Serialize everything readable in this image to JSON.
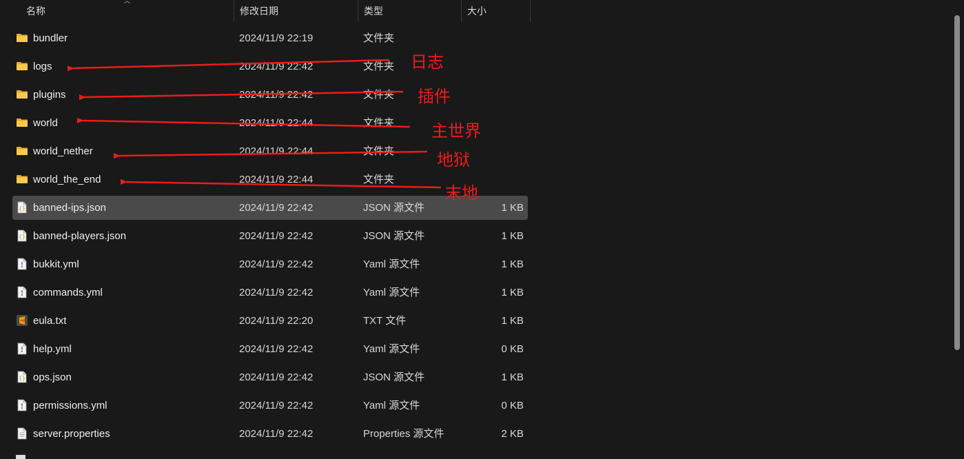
{
  "header": {
    "name": "名称",
    "date": "修改日期",
    "type": "类型",
    "size": "大小"
  },
  "files": [
    {
      "icon": "folder-icon",
      "name": "bundler",
      "date": "2024/11/9 22:19",
      "type": "文件夹",
      "size": ""
    },
    {
      "icon": "folder-icon",
      "name": "logs",
      "date": "2024/11/9 22:42",
      "type": "文件夹",
      "size": ""
    },
    {
      "icon": "folder-icon",
      "name": "plugins",
      "date": "2024/11/9 22:42",
      "type": "文件夹",
      "size": ""
    },
    {
      "icon": "folder-icon",
      "name": "world",
      "date": "2024/11/9 22:44",
      "type": "文件夹",
      "size": ""
    },
    {
      "icon": "folder-icon",
      "name": "world_nether",
      "date": "2024/11/9 22:44",
      "type": "文件夹",
      "size": ""
    },
    {
      "icon": "folder-icon",
      "name": "world_the_end",
      "date": "2024/11/9 22:44",
      "type": "文件夹",
      "size": ""
    },
    {
      "icon": "json-file-icon",
      "name": "banned-ips.json",
      "date": "2024/11/9 22:42",
      "type": "JSON 源文件",
      "size": "1 KB",
      "selected": true
    },
    {
      "icon": "json-file-icon",
      "name": "banned-players.json",
      "date": "2024/11/9 22:42",
      "type": "JSON 源文件",
      "size": "1 KB"
    },
    {
      "icon": "yaml-file-icon",
      "name": "bukkit.yml",
      "date": "2024/11/9 22:42",
      "type": "Yaml 源文件",
      "size": "1 KB"
    },
    {
      "icon": "yaml-file-icon",
      "name": "commands.yml",
      "date": "2024/11/9 22:42",
      "type": "Yaml 源文件",
      "size": "1 KB"
    },
    {
      "icon": "sublime-text-file-icon",
      "name": "eula.txt",
      "date": "2024/11/9 22:20",
      "type": "TXT 文件",
      "size": "1 KB"
    },
    {
      "icon": "yaml-file-icon",
      "name": "help.yml",
      "date": "2024/11/9 22:42",
      "type": "Yaml 源文件",
      "size": "0 KB"
    },
    {
      "icon": "json-file-icon",
      "name": "ops.json",
      "date": "2024/11/9 22:42",
      "type": "JSON 源文件",
      "size": "1 KB"
    },
    {
      "icon": "yaml-file-icon",
      "name": "permissions.yml",
      "date": "2024/11/9 22:42",
      "type": "Yaml 源文件",
      "size": "0 KB"
    },
    {
      "icon": "generic-file-icon",
      "name": "server.properties",
      "date": "2024/11/9 22:42",
      "type": "Properties 源文件",
      "size": "2 KB"
    }
  ],
  "annotations": [
    {
      "label": "日志",
      "target": "logs"
    },
    {
      "label": "插件",
      "target": "plugins"
    },
    {
      "label": "主世界",
      "target": "world"
    },
    {
      "label": "地狱",
      "target": "world_nether"
    },
    {
      "label": "末地",
      "target": "world_the_end"
    }
  ],
  "colors": {
    "background": "#191919",
    "selected_row": "#4a4a4a",
    "annotation": "#ee1b1b",
    "folder": "#f4c14a"
  }
}
